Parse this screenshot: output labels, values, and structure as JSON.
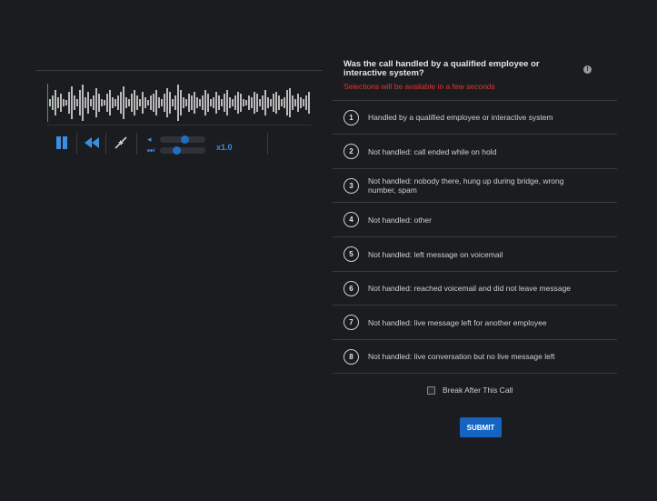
{
  "player": {
    "playback_rate": "x1.0",
    "volume_level": 0.55,
    "speed_level": 0.35,
    "icons": {
      "pause": "pause-icon",
      "rewind": "rewind-icon",
      "shrink": "shrink-icon",
      "volume": "volume-icon",
      "speed": "fast-forward-icon"
    }
  },
  "question": {
    "title": "Was the call handled by a qualified employee or interactive system?",
    "notice": "Selections will be available in a few seconds",
    "info_icon": "info-icon",
    "options": [
      {
        "num": "1",
        "label": "Handled by a qualified employee or interactive system"
      },
      {
        "num": "2",
        "label": "Not handled: call ended while on hold"
      },
      {
        "num": "3",
        "label": "Not handled: nobody there, hung up during bridge, wrong number, spam"
      },
      {
        "num": "4",
        "label": "Not handled: other"
      },
      {
        "num": "5",
        "label": "Not handled: left message on voicemail"
      },
      {
        "num": "6",
        "label": "Not handled: reached voicemail and did not leave message"
      },
      {
        "num": "7",
        "label": "Not handled: live message left for another employee"
      },
      {
        "num": "8",
        "label": "Not handled: live conversation but no live message left"
      }
    ]
  },
  "break_label": "Break After This Call",
  "submit_label": "SUBMIT",
  "colors": {
    "background": "#1b1c1f",
    "accent": "#1565c0",
    "notice": "#e0362c",
    "cursor": "#3fa34d"
  }
}
